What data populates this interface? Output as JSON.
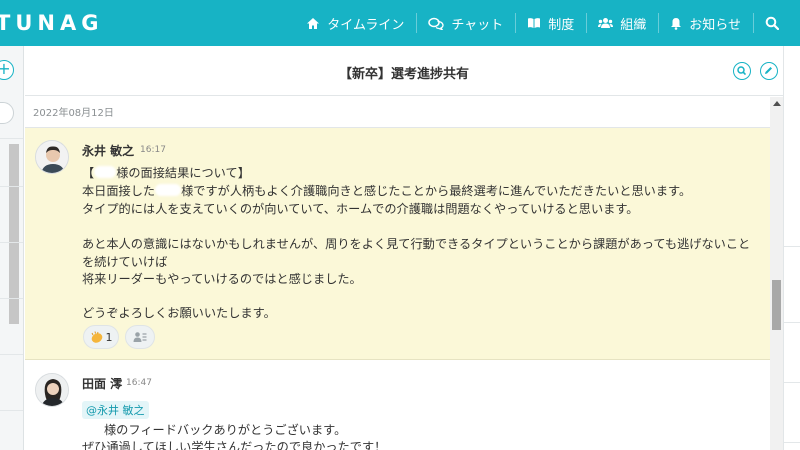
{
  "app": {
    "logo": "TUNAG"
  },
  "nav": {
    "items": [
      {
        "label": "タイムライン",
        "icon": "home-icon"
      },
      {
        "label": "チャット",
        "icon": "chat-icon"
      },
      {
        "label": "制度",
        "icon": "book-icon"
      },
      {
        "label": "組織",
        "icon": "people-icon"
      },
      {
        "label": "お知らせ",
        "icon": "bell-icon"
      }
    ],
    "search_icon": "search-icon"
  },
  "channel": {
    "title": "【新卒】選考進捗共有"
  },
  "timeline": {
    "date": "2022年08月12日"
  },
  "messages": [
    {
      "author": "永井 敏之",
      "time": "16:17",
      "lines": {
        "l1_pre": "【",
        "l1_post": "様の面接結果について】",
        "l2_pre": "本日面接した",
        "l2_post": "様ですが人柄もよく介護職向きと感じたことから最終選考に進んでいただきたいと思います。",
        "l3": "タイプ的には人を支えていくのが向いていて、ホームでの介護職は問題なくやっていけると思います。",
        "l4": "あと本人の意識にはないかもしれませんが、周りをよく見て行動できるタイプということから課題があっても逃げないこと",
        "l5": "を続けていけば",
        "l6": "将来リーダーもやっていけるのではと感じました。",
        "l7": "どうぞよろしくお願いいたします。"
      },
      "reactions": {
        "clap_count": "1"
      }
    },
    {
      "author": "田面 澪",
      "time": "16:47",
      "mention": "@永井 敏之",
      "lines": {
        "l1_post": "様のフィードバックありがとうございます。",
        "l2": "ぜひ通過してほしい学生さんだったので良かったです！"
      }
    }
  ],
  "colors": {
    "brand": "#17b3c5",
    "highlight": "#fbf8d8"
  }
}
